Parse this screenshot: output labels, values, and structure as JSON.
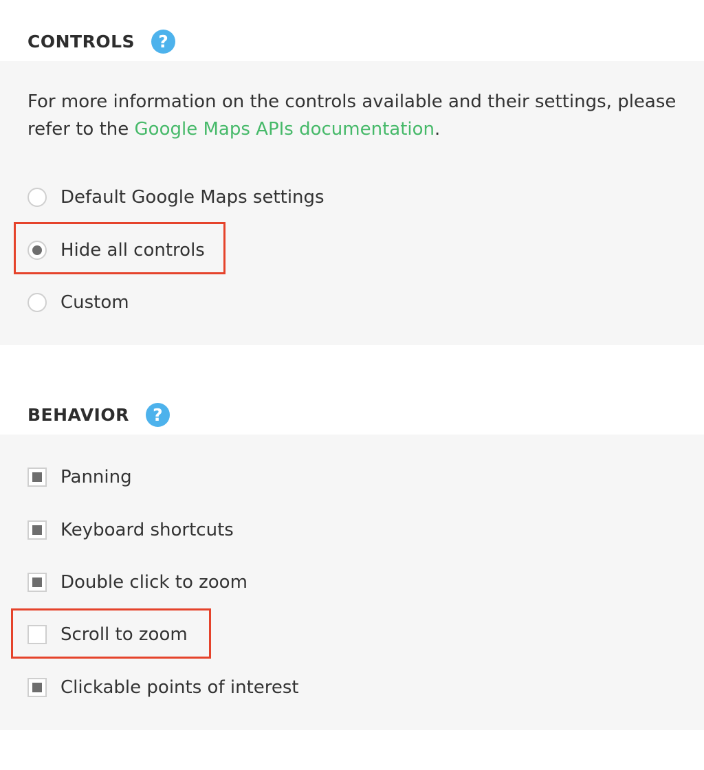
{
  "controls": {
    "title": "CONTROLS",
    "help_icon": "question-mark-icon",
    "description_text": "For more information on the controls available and their settings, please refer to the ",
    "description_link": "Google Maps APIs documentation",
    "description_end": ".",
    "options": [
      {
        "label": "Default Google Maps settings",
        "selected": false
      },
      {
        "label": "Hide all controls",
        "selected": true
      },
      {
        "label": "Custom",
        "selected": false
      }
    ]
  },
  "behavior": {
    "title": "BEHAVIOR",
    "help_icon": "question-mark-icon",
    "options": [
      {
        "label": "Panning",
        "checked": true
      },
      {
        "label": "Keyboard shortcuts",
        "checked": true
      },
      {
        "label": "Double click to zoom",
        "checked": true
      },
      {
        "label": "Scroll to zoom",
        "checked": false
      },
      {
        "label": "Clickable points of interest",
        "checked": true
      }
    ]
  },
  "colors": {
    "accent_link": "#46b969",
    "help_icon": "#4db2ec",
    "highlight": "#e5432b",
    "panel_bg": "#f6f6f6"
  },
  "help_glyph": "?"
}
